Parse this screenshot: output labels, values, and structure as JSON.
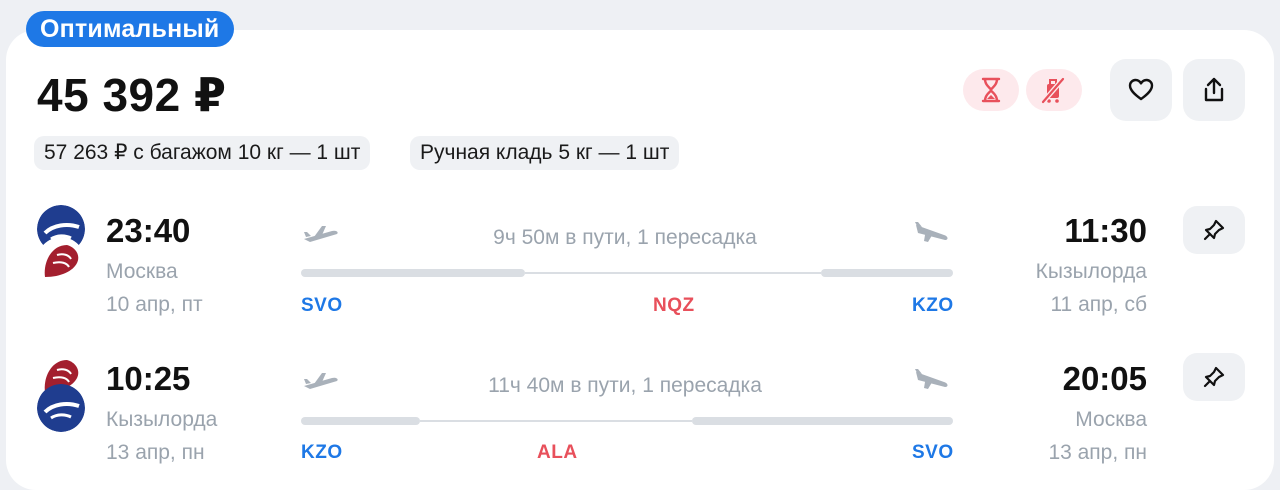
{
  "badge": "Оптимальный",
  "price": "45 392 ₽",
  "chips": {
    "baggage": "57 263 ₽ с багажом 10 кг — 1 шт",
    "hand": "Ручная кладь 5 кг — 1 шт"
  },
  "icons": {
    "hourglass": "hourglass-icon",
    "no_baggage": "no-baggage-icon",
    "favorite": "heart-icon",
    "share": "share-icon",
    "pin": "pin-icon"
  },
  "colors": {
    "accent": "#1e78e6",
    "hub_code": "#e8505b",
    "airport_code": "#1e78e6",
    "muted": "#9aa3ad"
  },
  "segments": [
    {
      "dep_time": "23:40",
      "dep_city": "Москва",
      "dep_date": "10 апр, пт",
      "arr_time": "11:30",
      "arr_city": "Кызылорда",
      "arr_date": "11 апр, сб",
      "duration": "9ч 50м в пути, 1 пересадка",
      "from": "SVO",
      "via": "NQZ",
      "to": "KZO"
    },
    {
      "dep_time": "10:25",
      "dep_city": "Кызылорда",
      "dep_date": "13 апр, пн",
      "arr_time": "20:05",
      "arr_city": "Москва",
      "arr_date": "13 апр, пн",
      "duration": "11ч 40м в пути, 1 пересадка",
      "from": "KZO",
      "via": "ALA",
      "to": "SVO"
    }
  ]
}
